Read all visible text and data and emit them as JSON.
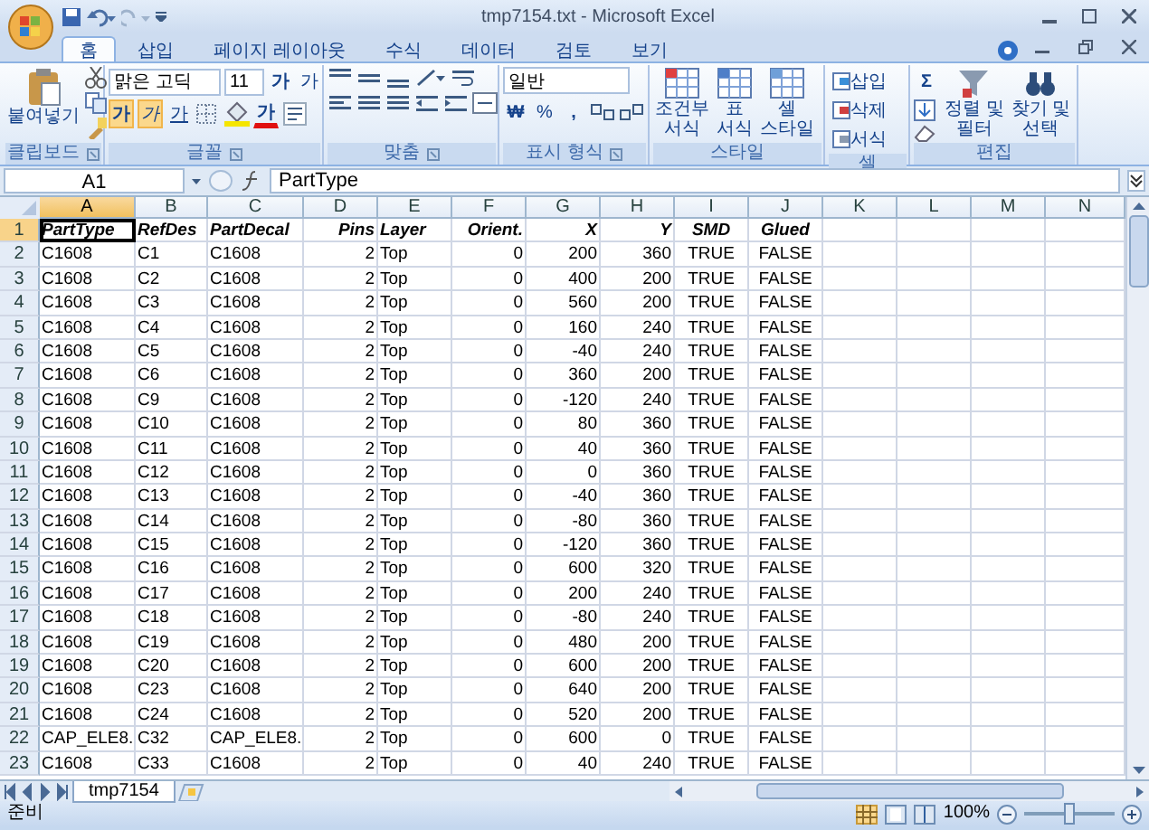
{
  "window": {
    "title": "tmp7154.txt - Microsoft Excel"
  },
  "tabs": [
    {
      "label": "홈",
      "selected": true
    },
    {
      "label": "삽입",
      "selected": false
    },
    {
      "label": "페이지 레이아웃",
      "selected": false
    },
    {
      "label": "수식",
      "selected": false
    },
    {
      "label": "데이터",
      "selected": false
    },
    {
      "label": "검토",
      "selected": false
    },
    {
      "label": "보기",
      "selected": false
    }
  ],
  "ribbon": {
    "clipboard": {
      "label": "클립보드",
      "paste": "붙여넣기"
    },
    "font": {
      "label": "글꼴",
      "font_name": "맑은 고딕",
      "font_size": "11",
      "grow": "가",
      "shrink": "가",
      "bold": "가",
      "italic": "가",
      "underline": "가",
      "font_color": "가"
    },
    "alignment": {
      "label": "맞춤"
    },
    "number": {
      "label": "표시 형식",
      "format": "일반",
      "currency": "₩",
      "percent": "%",
      "comma": ","
    },
    "styles": {
      "label": "스타일",
      "buttons": [
        [
          "조건부",
          "서식"
        ],
        [
          "표",
          "서식"
        ],
        [
          "셀",
          "스타일"
        ]
      ]
    },
    "cells": {
      "label": "셀",
      "buttons": [
        "삽입",
        "삭제",
        "서식"
      ]
    },
    "editing": {
      "label": "편집",
      "sum": "Σ",
      "buttons": [
        [
          "정렬 및",
          "필터"
        ],
        [
          "찾기 및",
          "선택"
        ]
      ]
    }
  },
  "formula_bar": {
    "name_box": "A1",
    "value": "PartType"
  },
  "columns": [
    {
      "label": "A",
      "selected": true
    },
    {
      "label": "B",
      "selected": false
    },
    {
      "label": "C",
      "selected": false
    },
    {
      "label": "D",
      "selected": false
    },
    {
      "label": "E",
      "selected": false
    },
    {
      "label": "F",
      "selected": false
    },
    {
      "label": "G",
      "selected": false
    },
    {
      "label": "H",
      "selected": false
    },
    {
      "label": "I",
      "selected": false
    },
    {
      "label": "J",
      "selected": false
    },
    {
      "label": "K",
      "selected": false
    },
    {
      "label": "L",
      "selected": false
    },
    {
      "label": "M",
      "selected": false
    },
    {
      "label": "N",
      "selected": false
    }
  ],
  "rows": [
    {
      "number": "1",
      "selected": true,
      "kind": "header",
      "cells": [
        "PartType",
        "RefDes",
        "PartDecal",
        "Pins",
        "Layer",
        "Orient.",
        "X",
        "Y",
        "SMD",
        "Glued"
      ]
    },
    {
      "number": "2",
      "selected": false,
      "kind": "data",
      "cells": [
        "C1608",
        "C1",
        "C1608",
        "2",
        "Top",
        "0",
        "200",
        "360",
        "TRUE",
        "FALSE"
      ]
    },
    {
      "number": "3",
      "selected": false,
      "kind": "data",
      "cells": [
        "C1608",
        "C2",
        "C1608",
        "2",
        "Top",
        "0",
        "400",
        "200",
        "TRUE",
        "FALSE"
      ]
    },
    {
      "number": "4",
      "selected": false,
      "kind": "data",
      "cells": [
        "C1608",
        "C3",
        "C1608",
        "2",
        "Top",
        "0",
        "560",
        "200",
        "TRUE",
        "FALSE"
      ]
    },
    {
      "number": "5",
      "selected": false,
      "kind": "data",
      "cells": [
        "C1608",
        "C4",
        "C1608",
        "2",
        "Top",
        "0",
        "160",
        "240",
        "TRUE",
        "FALSE"
      ]
    },
    {
      "number": "6",
      "selected": false,
      "kind": "data",
      "cells": [
        "C1608",
        "C5",
        "C1608",
        "2",
        "Top",
        "0",
        "-40",
        "240",
        "TRUE",
        "FALSE"
      ]
    },
    {
      "number": "7",
      "selected": false,
      "kind": "data",
      "cells": [
        "C1608",
        "C6",
        "C1608",
        "2",
        "Top",
        "0",
        "360",
        "200",
        "TRUE",
        "FALSE"
      ]
    },
    {
      "number": "8",
      "selected": false,
      "kind": "data",
      "cells": [
        "C1608",
        "C9",
        "C1608",
        "2",
        "Top",
        "0",
        "-120",
        "240",
        "TRUE",
        "FALSE"
      ]
    },
    {
      "number": "9",
      "selected": false,
      "kind": "data",
      "cells": [
        "C1608",
        "C10",
        "C1608",
        "2",
        "Top",
        "0",
        "80",
        "360",
        "TRUE",
        "FALSE"
      ]
    },
    {
      "number": "10",
      "selected": false,
      "kind": "data",
      "cells": [
        "C1608",
        "C11",
        "C1608",
        "2",
        "Top",
        "0",
        "40",
        "360",
        "TRUE",
        "FALSE"
      ]
    },
    {
      "number": "11",
      "selected": false,
      "kind": "data",
      "cells": [
        "C1608",
        "C12",
        "C1608",
        "2",
        "Top",
        "0",
        "0",
        "360",
        "TRUE",
        "FALSE"
      ]
    },
    {
      "number": "12",
      "selected": false,
      "kind": "data",
      "cells": [
        "C1608",
        "C13",
        "C1608",
        "2",
        "Top",
        "0",
        "-40",
        "360",
        "TRUE",
        "FALSE"
      ]
    },
    {
      "number": "13",
      "selected": false,
      "kind": "data",
      "cells": [
        "C1608",
        "C14",
        "C1608",
        "2",
        "Top",
        "0",
        "-80",
        "360",
        "TRUE",
        "FALSE"
      ]
    },
    {
      "number": "14",
      "selected": false,
      "kind": "data",
      "cells": [
        "C1608",
        "C15",
        "C1608",
        "2",
        "Top",
        "0",
        "-120",
        "360",
        "TRUE",
        "FALSE"
      ]
    },
    {
      "number": "15",
      "selected": false,
      "kind": "data",
      "cells": [
        "C1608",
        "C16",
        "C1608",
        "2",
        "Top",
        "0",
        "600",
        "320",
        "TRUE",
        "FALSE"
      ]
    },
    {
      "number": "16",
      "selected": false,
      "kind": "data",
      "cells": [
        "C1608",
        "C17",
        "C1608",
        "2",
        "Top",
        "0",
        "200",
        "240",
        "TRUE",
        "FALSE"
      ]
    },
    {
      "number": "17",
      "selected": false,
      "kind": "data",
      "cells": [
        "C1608",
        "C18",
        "C1608",
        "2",
        "Top",
        "0",
        "-80",
        "240",
        "TRUE",
        "FALSE"
      ]
    },
    {
      "number": "18",
      "selected": false,
      "kind": "data",
      "cells": [
        "C1608",
        "C19",
        "C1608",
        "2",
        "Top",
        "0",
        "480",
        "200",
        "TRUE",
        "FALSE"
      ]
    },
    {
      "number": "19",
      "selected": false,
      "kind": "data",
      "cells": [
        "C1608",
        "C20",
        "C1608",
        "2",
        "Top",
        "0",
        "600",
        "200",
        "TRUE",
        "FALSE"
      ]
    },
    {
      "number": "20",
      "selected": false,
      "kind": "data",
      "cells": [
        "C1608",
        "C23",
        "C1608",
        "2",
        "Top",
        "0",
        "640",
        "200",
        "TRUE",
        "FALSE"
      ]
    },
    {
      "number": "21",
      "selected": false,
      "kind": "data",
      "cells": [
        "C1608",
        "C24",
        "C1608",
        "2",
        "Top",
        "0",
        "520",
        "200",
        "TRUE",
        "FALSE"
      ]
    },
    {
      "number": "22",
      "selected": false,
      "kind": "data",
      "cells": [
        "CAP_ELE8.",
        "C32",
        "CAP_ELE8.",
        "2",
        "Top",
        "0",
        "600",
        "0",
        "TRUE",
        "FALSE"
      ]
    },
    {
      "number": "23",
      "selected": false,
      "kind": "data",
      "cells": [
        "C1608",
        "C33",
        "C1608",
        "2",
        "Top",
        "0",
        "40",
        "240",
        "TRUE",
        "FALSE"
      ]
    }
  ],
  "sheet_tabs": [
    {
      "label": "tmp7154",
      "selected": true
    }
  ],
  "status_bar": {
    "status": "준비",
    "zoom": "100%",
    "zoom_slider": {
      "level": 0.5
    }
  }
}
